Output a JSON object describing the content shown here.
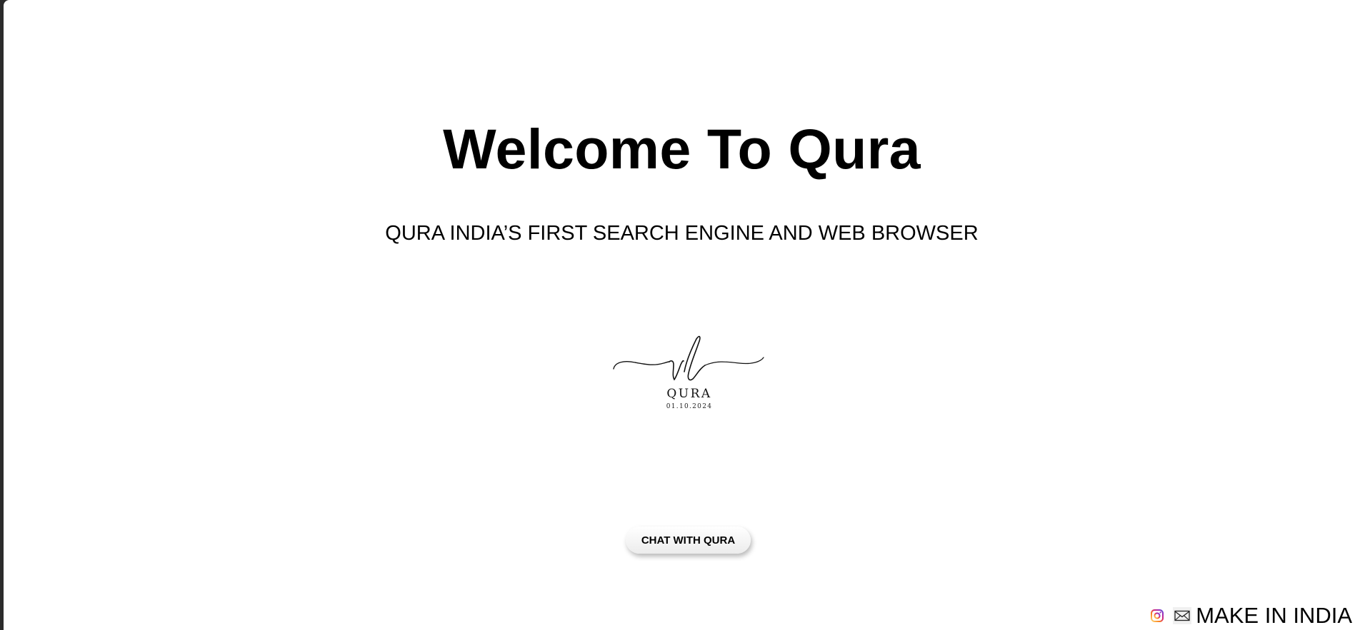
{
  "hero": {
    "title": "Welcome To Qura",
    "subtitle": "QURA INDIA’S FIRST SEARCH ENGINE AND WEB BROWSER"
  },
  "logo": {
    "monogram": "vl",
    "name": "QURA",
    "date": "01.10.2024"
  },
  "cta": {
    "label": "CHAT WITH QURA"
  },
  "footer": {
    "icons": [
      "instagram-icon",
      "mail-icon"
    ],
    "tagline": "MAKE IN INDIA"
  }
}
